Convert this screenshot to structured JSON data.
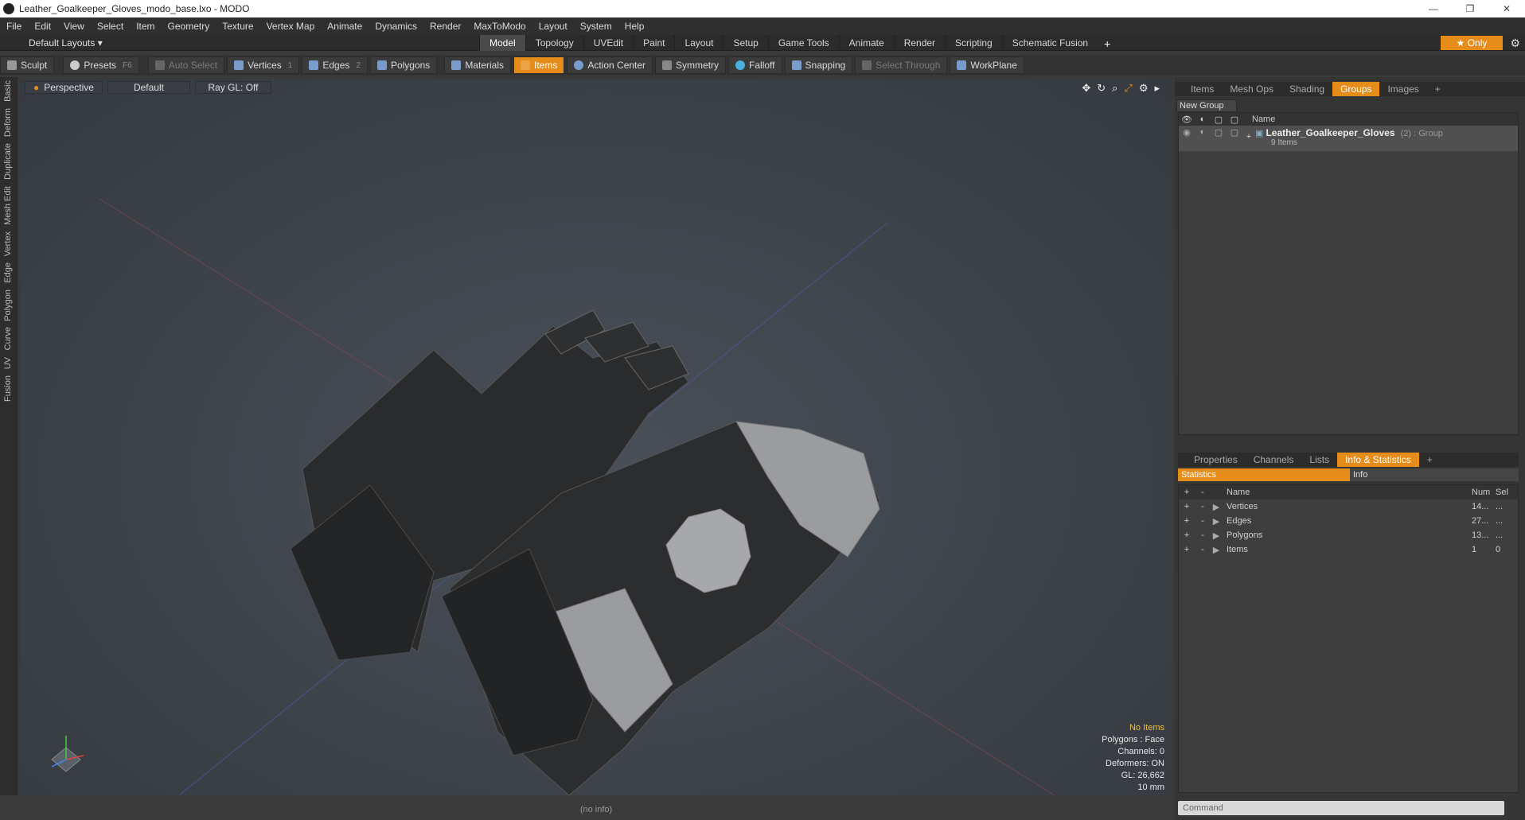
{
  "window": {
    "title": "Leather_Goalkeeper_Gloves_modo_base.lxo - MODO"
  },
  "menu": [
    "File",
    "Edit",
    "View",
    "Select",
    "Item",
    "Geometry",
    "Texture",
    "Vertex Map",
    "Animate",
    "Dynamics",
    "Render",
    "MaxToModo",
    "Layout",
    "System",
    "Help"
  ],
  "layouts": {
    "label": "Default Layouts"
  },
  "layout_tabs": [
    "Model",
    "Topology",
    "UVEdit",
    "Paint",
    "Layout",
    "Setup",
    "Game Tools",
    "Animate",
    "Render",
    "Scripting",
    "Schematic Fusion"
  ],
  "only_label": "Only",
  "toolbar": {
    "sculpt": "Sculpt",
    "presets": "Presets",
    "presets_key": "F6",
    "auto_select": "Auto Select",
    "vertices": "Vertices",
    "vertices_key": "1",
    "edges": "Edges",
    "edges_key": "2",
    "polygons": "Polygons",
    "materials": "Materials",
    "items": "Items",
    "action_center": "Action Center",
    "symmetry": "Symmetry",
    "falloff": "Falloff",
    "snapping": "Snapping",
    "select_through": "Select Through",
    "workplane": "WorkPlane"
  },
  "left_tabs": [
    "Basic",
    "Deform",
    "Duplicate",
    "Mesh Edit",
    "Vertex",
    "Edge",
    "Polygon",
    "Curve",
    "UV",
    "Fusion"
  ],
  "viewport": {
    "view": "Perspective",
    "shading": "Default",
    "raygl": "Ray GL: Off",
    "stats": {
      "no_items": "No Items",
      "polygons": "Polygons : Face",
      "channels": "Channels: 0",
      "deformers": "Deformers: ON",
      "gl": "GL: 26,662",
      "unit": "10 mm"
    }
  },
  "status": "(no info)",
  "top_panel": {
    "tabs": [
      "Items",
      "Mesh Ops",
      "Shading",
      "Groups",
      "Images"
    ],
    "new_group": "New Group",
    "name_header": "Name",
    "group": {
      "name": "Leather_Goalkeeper_Gloves",
      "suffix": "(2) : Group",
      "items": "9 Items"
    }
  },
  "bottom_panel": {
    "tabs": [
      "Properties",
      "Channels",
      "Lists",
      "Info & Statistics"
    ],
    "sub_tabs": {
      "statistics": "Statistics",
      "info": "Info"
    },
    "headers": {
      "name": "Name",
      "num": "Num",
      "sel": "Sel"
    },
    "rows": [
      {
        "name": "Vertices",
        "num": "14...",
        "sel": "..."
      },
      {
        "name": "Edges",
        "num": "27...",
        "sel": "..."
      },
      {
        "name": "Polygons",
        "num": "13...",
        "sel": "..."
      },
      {
        "name": "Items",
        "num": "1",
        "sel": "0"
      }
    ]
  },
  "command": {
    "placeholder": "Command"
  }
}
